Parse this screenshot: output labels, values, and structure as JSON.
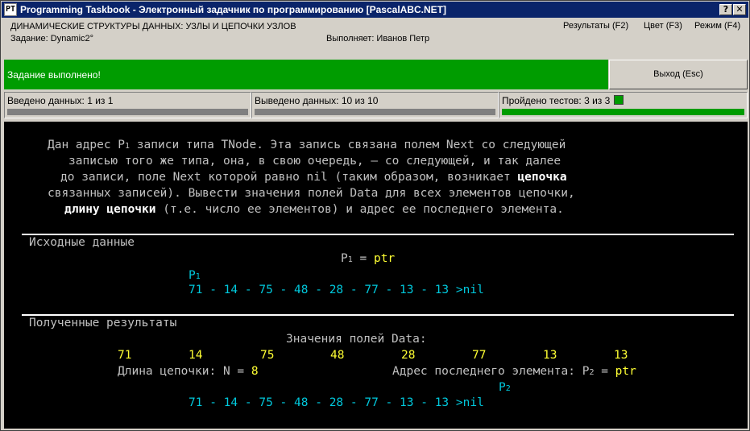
{
  "window": {
    "title": "Programming Taskbook - Электронный задачник по программированию [PascalABC.NET]",
    "help_btn": "?",
    "close_btn": "✕"
  },
  "header": {
    "topic": "ДИНАМИЧЕСКИЕ СТРУКТУРЫ ДАННЫХ: УЗЛЫ И ЦЕПОЧКИ УЗЛОВ",
    "task": "Задание: Dynamic2°",
    "performer": "Выполняет: Иванов Петр",
    "menu": [
      "Результаты (F2)",
      "Цвет (F3)",
      "Режим (F4)"
    ]
  },
  "status": {
    "message": "Задание выполнено!",
    "exit_label": "Выход (Esc)",
    "color": "#009c00"
  },
  "progress": {
    "input": {
      "label": "Введено данных: 1 из 1",
      "fraction": 1.0
    },
    "output": {
      "label": "Выведено данных: 10 из 10",
      "fraction": 1.0
    },
    "tests": {
      "label": "Пройдено тестов: 3 из 3",
      "fraction": 1.0
    }
  },
  "task_text": {
    "l1": "Дан адрес P",
    "l1_sub": "1",
    "l1_rest": " записи типа TNode. Эта запись связана полем Next со следующей",
    "l2": "записью того же типа, она, в свою очередь, — со следующей, и так далее",
    "l3a": "до записи, поле Next которой равно nil (таким образом, возникает ",
    "l3b": "цепочка",
    "l4": "связанных записей). Вывести значения полей Data для всех элементов цепочки,",
    "l5a": "длину цепочки",
    "l5b": " (т.е. число ее элементов) и адрес ее последнего элемента."
  },
  "input_section": {
    "title": "Исходные данные",
    "ptr_label": "P",
    "ptr_sub": "1",
    "ptr_eq": " = ",
    "ptr_val": "ptr",
    "chain_marker": "P",
    "chain_marker_sub": "1",
    "chain": [
      "71",
      "14",
      "75",
      "48",
      "28",
      "77",
      "13",
      "13"
    ],
    "chain_end": ">nil"
  },
  "result_section": {
    "title": "Полученные результаты",
    "data_label": "Значения полей Data:",
    "values": [
      "71",
      "14",
      "75",
      "48",
      "28",
      "77",
      "13",
      "13"
    ],
    "length_label": "Длина цепочки: N = ",
    "length_value": "8",
    "last_addr_label": "Адрес последнего элемента: P",
    "last_addr_sub": "2",
    "last_addr_eq": " = ",
    "last_addr_val": "ptr",
    "chain_marker": "P",
    "chain_marker_sub": "2",
    "chain": [
      "71",
      "14",
      "75",
      "48",
      "28",
      "77",
      "13",
      "13"
    ],
    "chain_end": ">nil"
  }
}
